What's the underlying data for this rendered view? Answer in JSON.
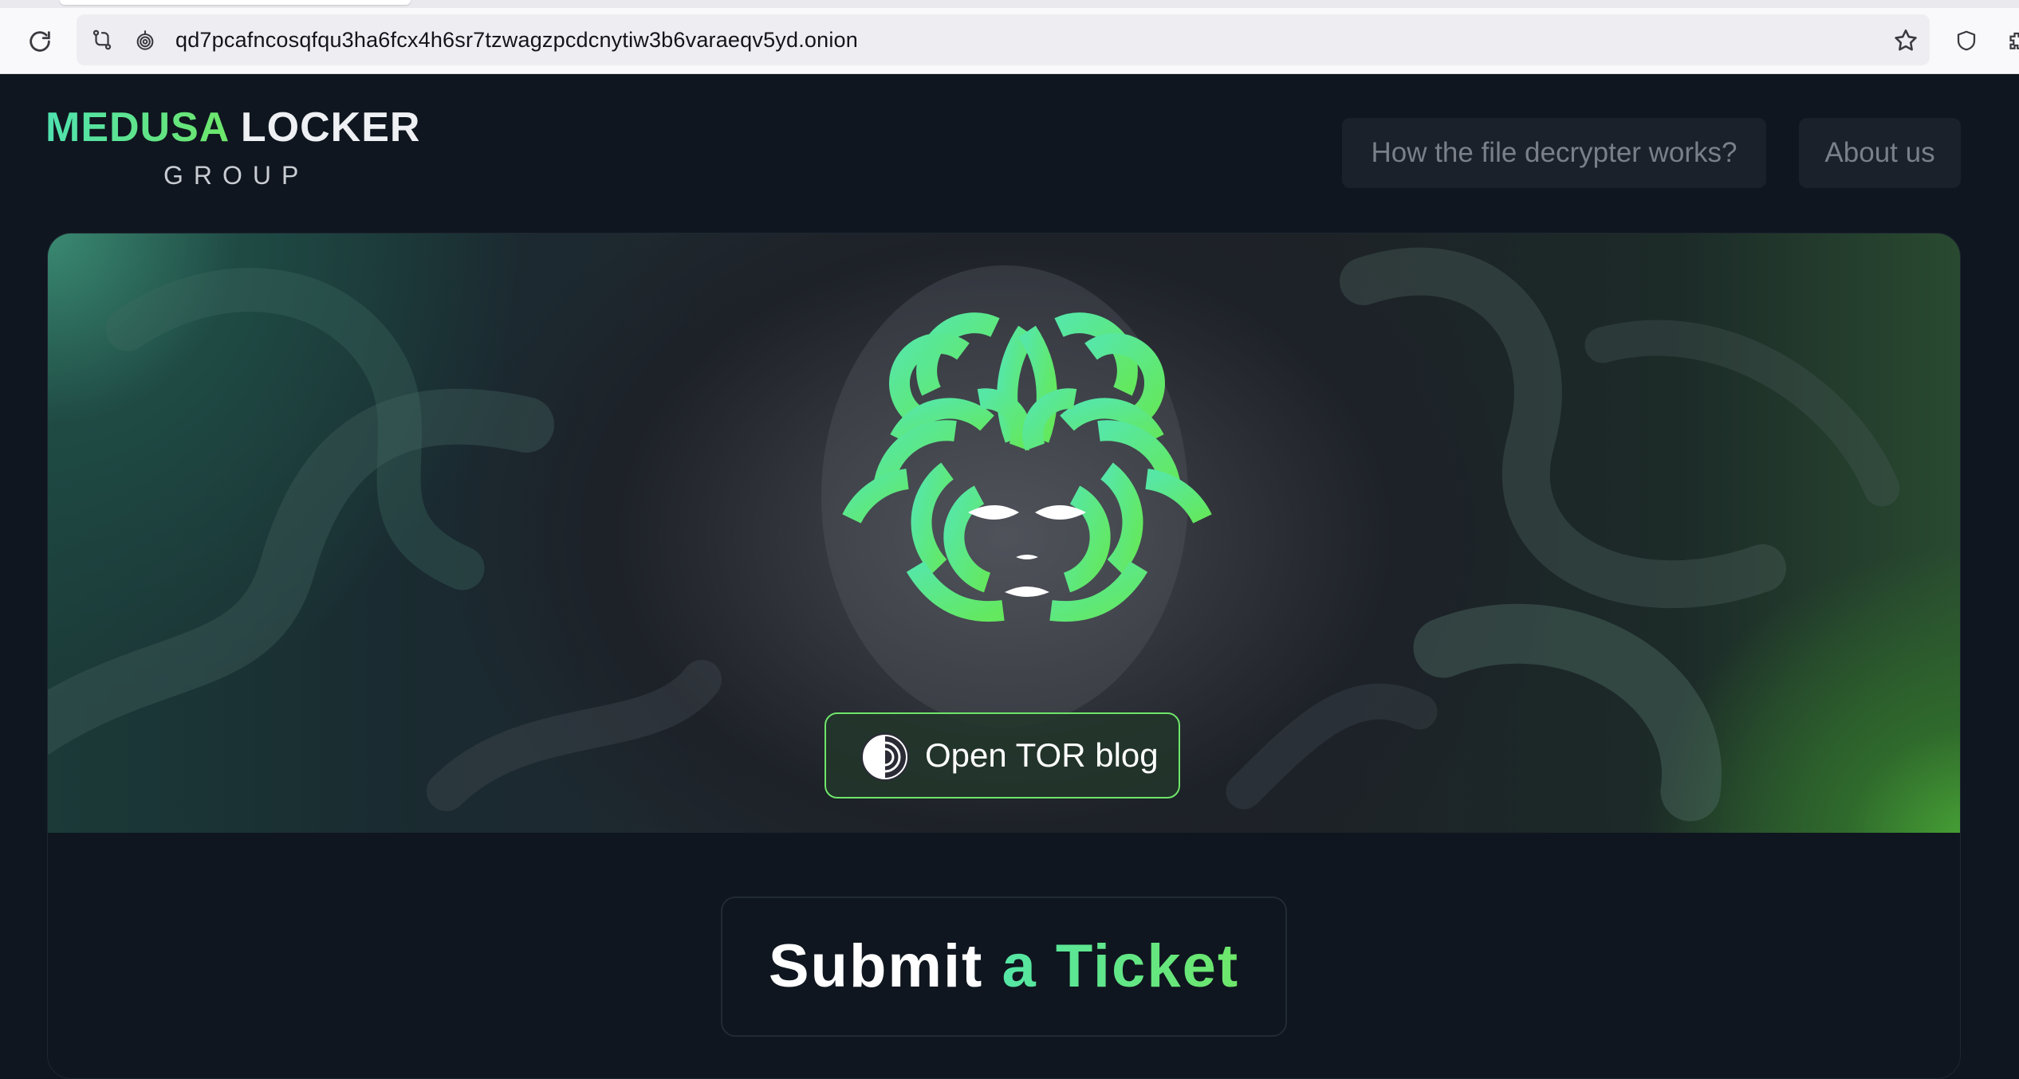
{
  "browser": {
    "url": "qd7pcafncosqfqu3ha6fcx4h6sr7tzwagzpcdcnytiw3b6varaeqv5yd.onion",
    "icons": [
      "reload-icon",
      "tracker-icon",
      "onion-lock-icon",
      "bookmark-star-icon",
      "shield-icon",
      "extension-icon"
    ]
  },
  "header": {
    "logo_word1": "MEDUSA",
    "logo_word2": "LOCKER",
    "logo_sub": "GROUP",
    "nav": {
      "how_label": "How the file decrypter works?",
      "about_label": "About us"
    }
  },
  "hero": {
    "tor_button_label": "Open TOR blog"
  },
  "ticket": {
    "title_part1": "Submit",
    "title_part2": "a Ticket"
  },
  "colors": {
    "accent_green": "#6ee66a",
    "accent_teal": "#55e6a5",
    "background": "#0f161f"
  }
}
